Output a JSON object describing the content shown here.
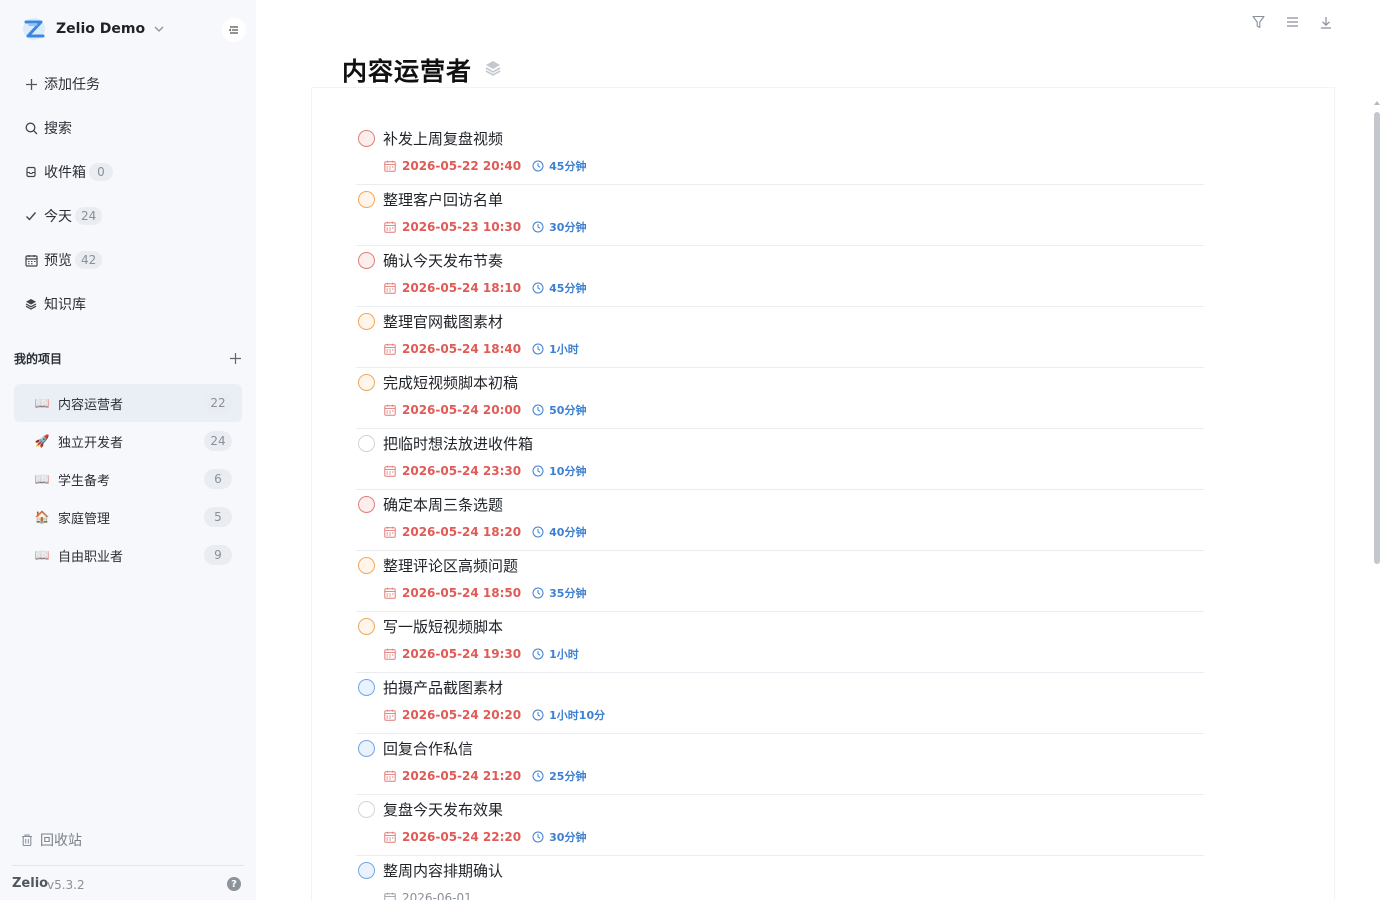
{
  "workspace": {
    "name": "Zelio Demo"
  },
  "nav": {
    "add_task": "添加任务",
    "search": "搜索",
    "inbox": {
      "label": "收件箱",
      "count": "0"
    },
    "today": {
      "label": "今天",
      "count": "24"
    },
    "preview": {
      "label": "预览",
      "count": "42"
    },
    "knowledge": "知识库"
  },
  "projects": {
    "heading": "我的项目",
    "items": [
      {
        "emoji": "📖",
        "label": "内容运营者",
        "count": "22"
      },
      {
        "emoji": "🚀",
        "label": "独立开发者",
        "count": "24"
      },
      {
        "emoji": "📖",
        "label": "学生备考",
        "count": "6"
      },
      {
        "emoji": "🏠",
        "label": "家庭管理",
        "count": "5"
      },
      {
        "emoji": "📖",
        "label": "自由职业者",
        "count": "9"
      }
    ]
  },
  "footer": {
    "trash": "回收站",
    "brand": "Zelio",
    "version": "v5.3.2",
    "help": "?"
  },
  "main": {
    "title": "内容运营者",
    "tasks": [
      {
        "title": "补发上周复盘视频",
        "due": "2026-05-22 20:40",
        "duration": "45分钟",
        "priority": "red"
      },
      {
        "title": "整理客户回访名单",
        "due": "2026-05-23 10:30",
        "duration": "30分钟",
        "priority": "orange"
      },
      {
        "title": "确认今天发布节奏",
        "due": "2026-05-24 18:10",
        "duration": "45分钟",
        "priority": "red"
      },
      {
        "title": "整理官网截图素材",
        "due": "2026-05-24 18:40",
        "duration": "1小时",
        "priority": "orange"
      },
      {
        "title": "完成短视频脚本初稿",
        "due": "2026-05-24 20:00",
        "duration": "50分钟",
        "priority": "orange"
      },
      {
        "title": "把临时想法放进收件箱",
        "due": "2026-05-24 23:30",
        "duration": "10分钟",
        "priority": "none"
      },
      {
        "title": "确定本周三条选题",
        "due": "2026-05-24 18:20",
        "duration": "40分钟",
        "priority": "red"
      },
      {
        "title": "整理评论区高频问题",
        "due": "2026-05-24 18:50",
        "duration": "35分钟",
        "priority": "orange"
      },
      {
        "title": "写一版短视频脚本",
        "due": "2026-05-24 19:30",
        "duration": "1小时",
        "priority": "orange"
      },
      {
        "title": "拍摄产品截图素材",
        "due": "2026-05-24 20:20",
        "duration": "1小时10分",
        "priority": "blue"
      },
      {
        "title": "回复合作私信",
        "due": "2026-05-24 21:20",
        "duration": "25分钟",
        "priority": "blue"
      },
      {
        "title": "复盘今天发布效果",
        "due": "2026-05-24 22:20",
        "duration": "30分钟",
        "priority": "none"
      },
      {
        "title": "整周内容排期确认",
        "due": "2026-06-01",
        "duration": "",
        "priority": "blue"
      }
    ]
  },
  "colors": {
    "accent": "#3d7fd0",
    "overdue": "#e05a56",
    "sidebar_bg": "#f6f8fb"
  },
  "icons": {
    "toolbar": [
      "filter-icon",
      "menu-icon",
      "download-icon"
    ],
    "task_meta": [
      "calendar-icon",
      "clock-icon"
    ]
  }
}
